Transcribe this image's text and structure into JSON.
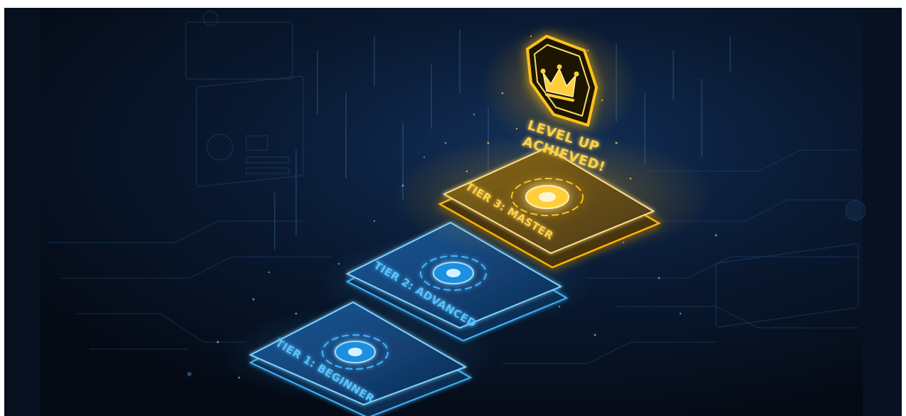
{
  "tiers": [
    {
      "label": "TIER 1: BEGINNER",
      "color": "#3fb6ff",
      "status": "complete"
    },
    {
      "label": "TIER 2: ADVANCED",
      "color": "#3fb6ff",
      "status": "complete"
    },
    {
      "label": "TIER 3: MASTER",
      "color": "#ffc21a",
      "status": "achieved"
    }
  ],
  "badge": {
    "icon": "crown-icon",
    "line1": "LEVEL UP",
    "line2": "ACHIEVED!",
    "color": "#ffc21a"
  },
  "colors": {
    "background": "#050c18",
    "accent_blue": "#3fb6ff",
    "accent_gold": "#ffc21a"
  }
}
